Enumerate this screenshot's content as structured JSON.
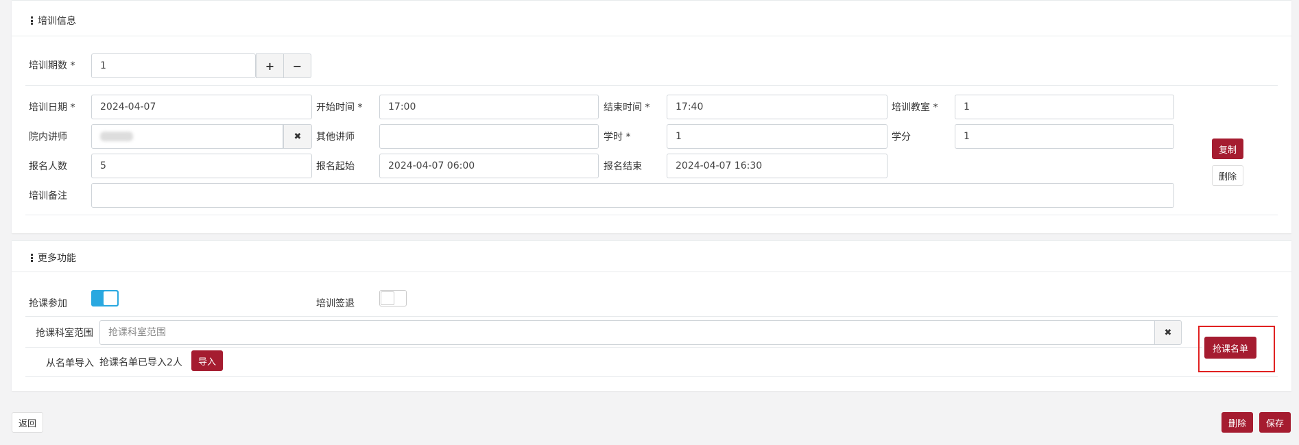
{
  "training_panel": {
    "title": "培训信息",
    "sessions_label": "培训期数 *",
    "sessions_value": "1",
    "plus_icon": "+",
    "minus_icon": "−",
    "date_label": "培训日期 *",
    "date_value": "2024-04-07",
    "start_label": "开始时间 *",
    "start_value": "17:00",
    "end_label": "结束时间 *",
    "end_value": "17:40",
    "room_label": "培训教室 *",
    "room_value": "1",
    "inner_teacher_label": "院内讲师",
    "clear_icon": "✖",
    "other_teacher_label": "其他讲师",
    "other_teacher_value": "",
    "hours_label": "学时 *",
    "hours_value": "1",
    "credit_label": "学分",
    "credit_value": "1",
    "enroll_count_label": "报名人数",
    "enroll_count_value": "5",
    "enroll_start_label": "报名起始",
    "enroll_start_value": "2024-04-07 06:00",
    "enroll_end_label": "报名结束",
    "enroll_end_value": "2024-04-07 16:30",
    "remark_label": "培训备注",
    "remark_value": "",
    "copy_button": "复制",
    "delete_button": "删除"
  },
  "more_panel": {
    "title": "更多功能",
    "grab_label": "抢课参加",
    "grab_toggle_on": true,
    "signout_label": "培训签退",
    "signout_toggle_on": false,
    "dept_range_label": "抢课科室范围",
    "dept_range_placeholder": "抢课科室范围",
    "clear_icon": "✖",
    "import_label": "从名单导入",
    "import_status": "抢课名单已导入2人",
    "import_button": "导入",
    "grab_list_button": "抢课名单",
    "highlight_color": "#e02020"
  },
  "footer": {
    "back_button": "返回",
    "delete_button": "删除",
    "save_button": "保存"
  },
  "colors": {
    "accent_red": "#a51c30",
    "toggle_blue": "#29a8e0"
  }
}
